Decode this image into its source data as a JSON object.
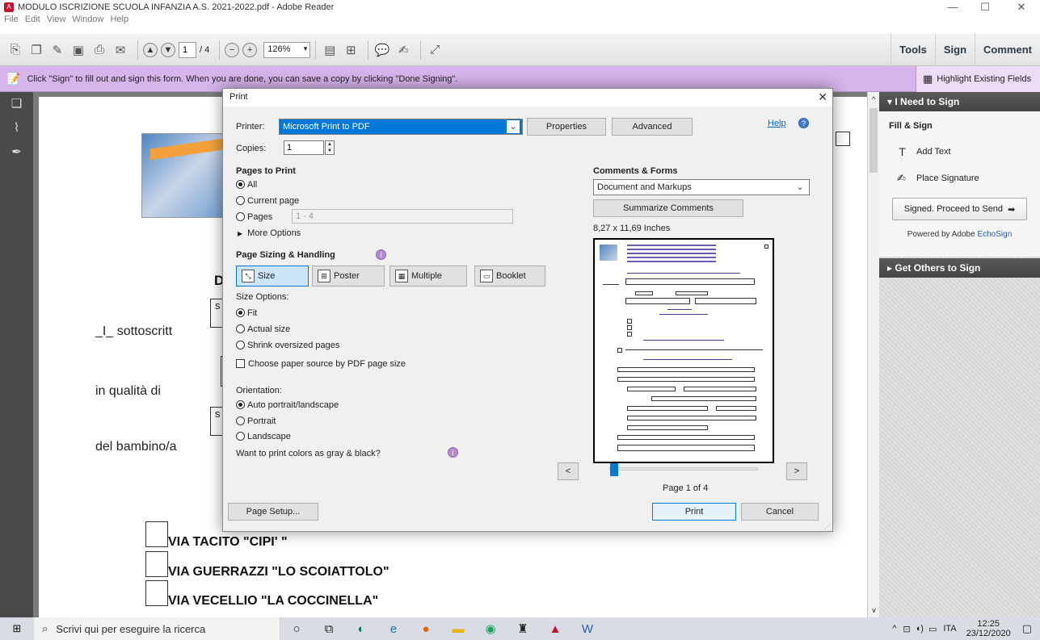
{
  "window": {
    "title": "MODULO ISCRIZIONE SCUOLA INFANZIA A.S. 2021-2022.pdf - Adobe Reader",
    "menu": [
      "File",
      "Edit",
      "View",
      "Window",
      "Help"
    ],
    "minimize": "—",
    "maximize": "☐",
    "close": "✕"
  },
  "toolbar": {
    "page_current": "1",
    "page_total": "/ 4",
    "zoom": "126%",
    "right_tabs": [
      "Tools",
      "Sign",
      "Comment"
    ]
  },
  "banner": {
    "message": "Click \"Sign\" to fill out and sign this form. When you are done, you can save a copy by clicking \"Done Signing\".",
    "highlight_label": "Highlight Existing Fields"
  },
  "document": {
    "initial_d": "D",
    "sottoscritto": "_I_ sottoscritt",
    "in_qualita": "in qualità di",
    "del_bambino": "del bambino/a",
    "box_letter": "s",
    "options": [
      "VIA TACITO   \"CIPI' \"",
      "VIA GUERRAZZI \"LO SCOIATTOLO\"",
      "VIA VECELLIO    \"LA COCCINELLA\""
    ]
  },
  "sign_panel": {
    "need_to_sign": "I Need to Sign",
    "fill_sign": "Fill & Sign",
    "add_text": "Add Text",
    "place_signature": "Place Signature",
    "proceed_button": "Signed. Proceed to Send",
    "powered_by": "Powered by Adobe ",
    "echosign": "EchoSign",
    "get_others": "Get Others to Sign"
  },
  "print_dialog": {
    "title": "Print",
    "printer_label": "Printer:",
    "printer_value": "Microsoft Print to PDF",
    "properties": "Properties",
    "advanced": "Advanced",
    "help": "Help",
    "copies_label": "Copies:",
    "copies_value": "1",
    "pages_to_print": "Pages to Print",
    "all": "All",
    "current_page": "Current page",
    "pages": "Pages",
    "pages_range": "1 - 4",
    "more_options": "More Options",
    "page_sizing": "Page Sizing & Handling",
    "size_btn": "Size",
    "poster_btn": "Poster",
    "multiple_btn": "Multiple",
    "booklet_btn": "Booklet",
    "size_options": "Size Options:",
    "fit": "Fit",
    "actual_size": "Actual size",
    "shrink": "Shrink oversized pages",
    "choose_paper": "Choose paper source by PDF page size",
    "orientation": "Orientation:",
    "auto": "Auto portrait/landscape",
    "portrait": "Portrait",
    "landscape": "Landscape",
    "gray_question": "Want to print colors as gray & black?",
    "comments_forms": "Comments & Forms",
    "comments_value": "Document and Markups",
    "summarize": "Summarize Comments",
    "paper_size": "8,27 x 11,69 Inches",
    "prev": "<",
    "next": ">",
    "page_of": "Page 1 of 4",
    "page_setup": "Page Setup...",
    "print": "Print",
    "cancel": "Cancel"
  },
  "taskbar": {
    "search_placeholder": "Scrivi qui per eseguire la ricerca",
    "language": "ITA",
    "time": "12:25",
    "date": "23/12/2020"
  }
}
